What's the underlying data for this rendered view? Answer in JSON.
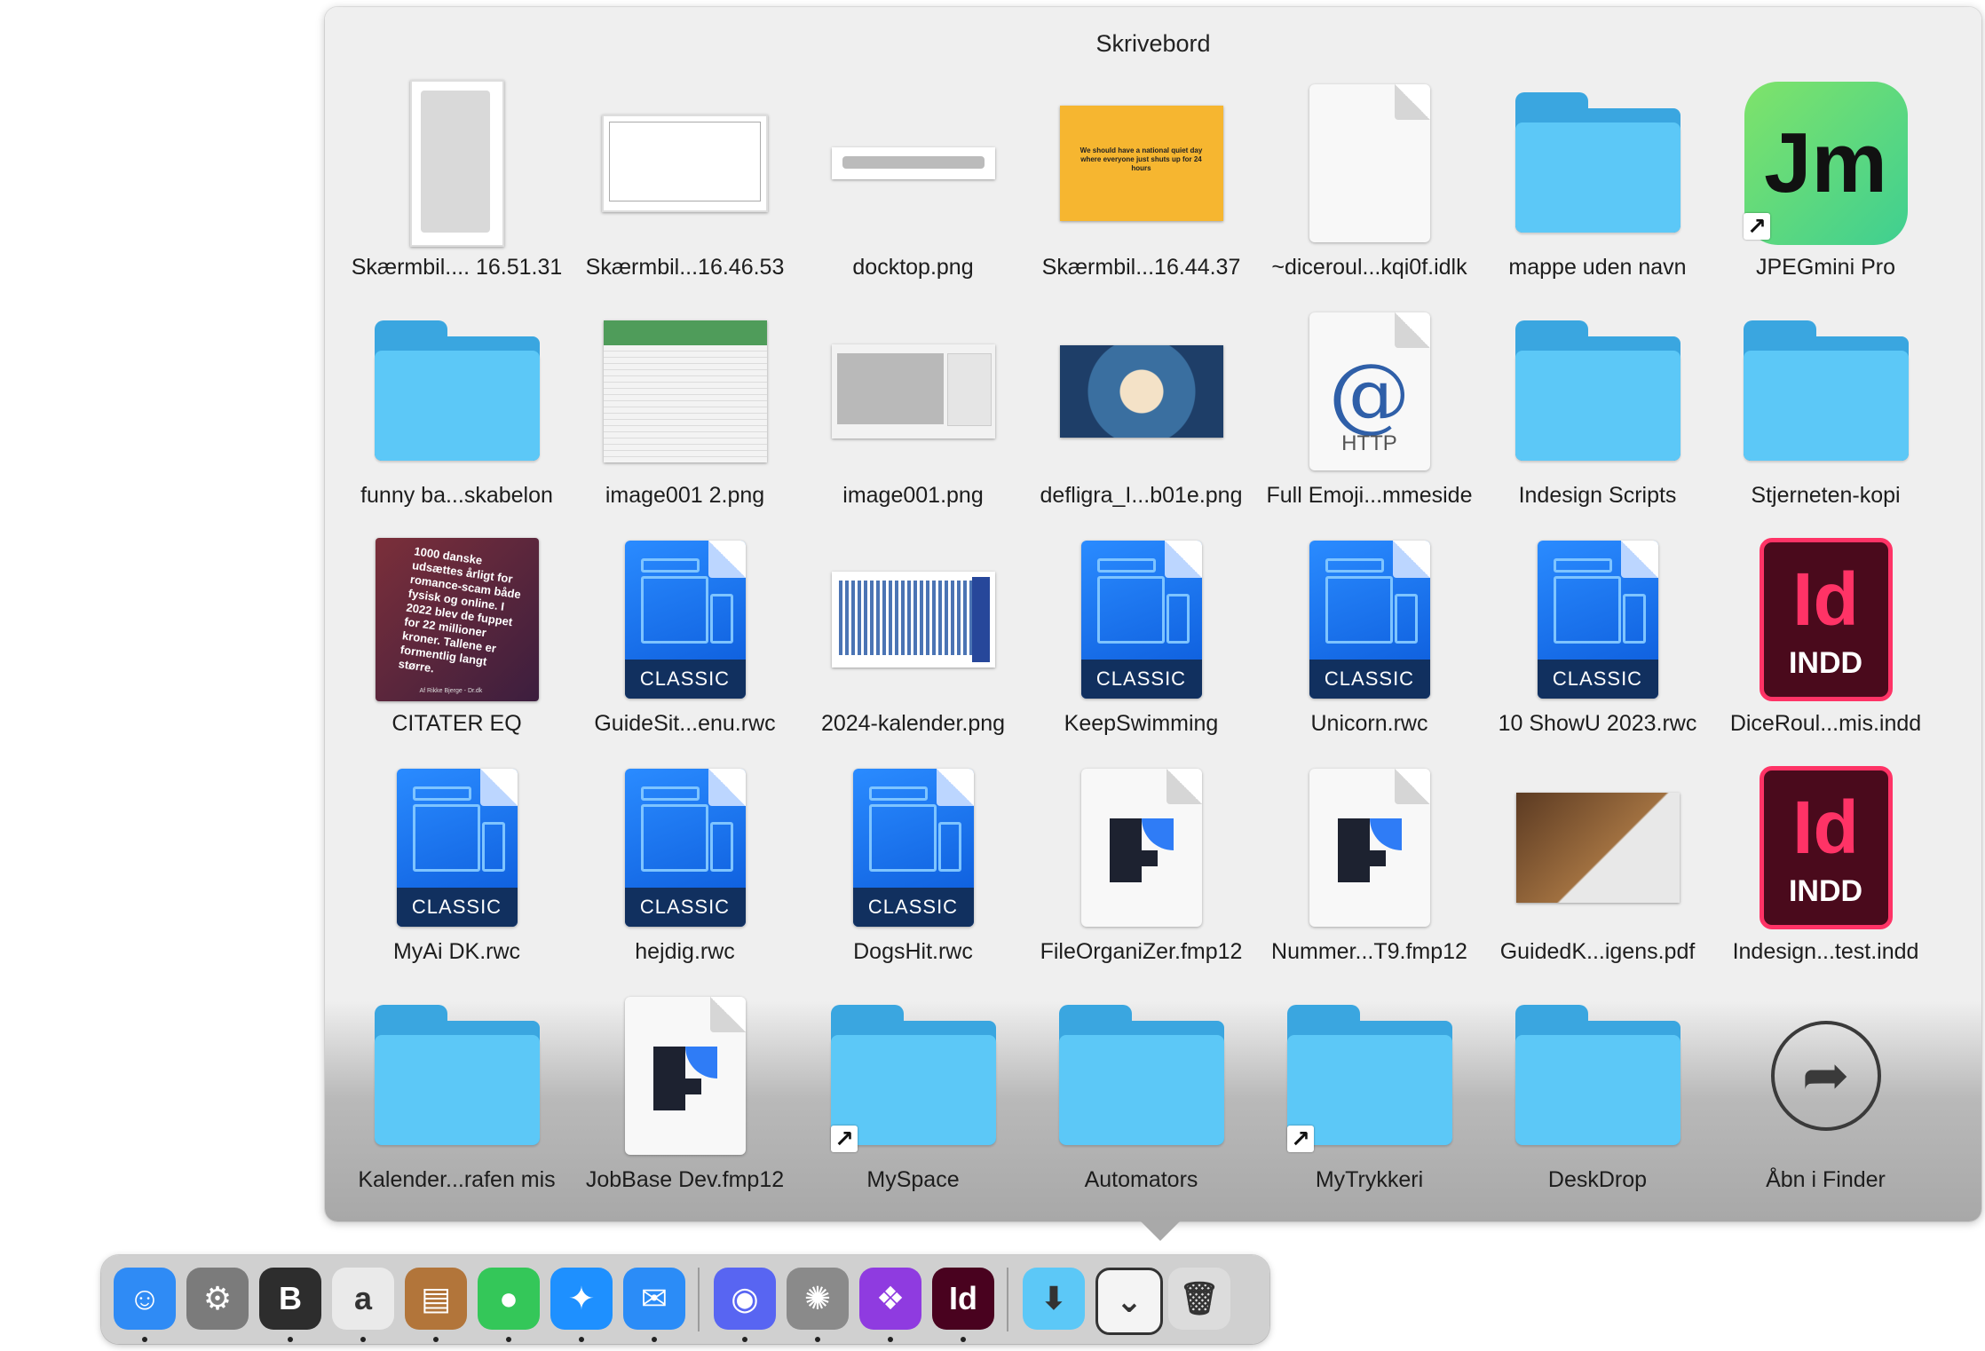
{
  "stack": {
    "title": "Skrivebord",
    "items": [
      {
        "label": "Skærmbil.... 16.51.31",
        "kind": "screenshot-menu"
      },
      {
        "label": "Skærmbil...16.46.53",
        "kind": "screenshot-blank"
      },
      {
        "label": "docktop.png",
        "kind": "screenshot-dock"
      },
      {
        "label": "Skærmbil...16.44.37",
        "kind": "screenshot-yellow",
        "thumb_text": "We should have a national quiet day where everyone just shuts up for 24 hours"
      },
      {
        "label": "~diceroul...kqi0f.idlk",
        "kind": "document"
      },
      {
        "label": "mappe uden navn",
        "kind": "folder"
      },
      {
        "label": "JPEGmini Pro",
        "kind": "app-jpegmini",
        "icon_text": "Jm",
        "alias": true
      },
      {
        "label": "funny ba...skabelon",
        "kind": "folder"
      },
      {
        "label": "image001 2.png",
        "kind": "screenshot-table"
      },
      {
        "label": "image001.png",
        "kind": "screenshot-app"
      },
      {
        "label": "defligra_I...b01e.png",
        "kind": "image-face"
      },
      {
        "label": "Full Emoji...mmeside",
        "kind": "http",
        "icon_text": "HTTP"
      },
      {
        "label": "Indesign Scripts",
        "kind": "folder"
      },
      {
        "label": "Stjerneten-kopi",
        "kind": "folder"
      },
      {
        "label": "CITATER EQ",
        "kind": "quote-image",
        "thumb_text": "1000 danske udsættes årligt for romance-scam både fysisk og online. I 2022 blev de fuppet for 22 millioner kroner. Tallene er formentlig langt større.",
        "thumb_credit": "Af Rikke Bjerge - Dr.dk"
      },
      {
        "label": "GuideSit...enu.rwc",
        "kind": "rwc",
        "icon_text": "CLASSIC"
      },
      {
        "label": "2024-kalender.png",
        "kind": "calendar"
      },
      {
        "label": "KeepSwimming",
        "kind": "rwc",
        "icon_text": "CLASSIC"
      },
      {
        "label": "Unicorn.rwc",
        "kind": "rwc",
        "icon_text": "CLASSIC"
      },
      {
        "label": "10 ShowU 2023.rwc",
        "kind": "rwc",
        "icon_text": "CLASSIC"
      },
      {
        "label": "DiceRoul...mis.indd",
        "kind": "indd",
        "icon_text": "Id",
        "icon_sub": "INDD"
      },
      {
        "label": "MyAi DK.rwc",
        "kind": "rwc",
        "icon_text": "CLASSIC"
      },
      {
        "label": "hejdig.rwc",
        "kind": "rwc",
        "icon_text": "CLASSIC"
      },
      {
        "label": "DogsHit.rwc",
        "kind": "rwc",
        "icon_text": "CLASSIC"
      },
      {
        "label": "FileOrganiZer.fmp12",
        "kind": "fmp"
      },
      {
        "label": "Nummer...T9.fmp12",
        "kind": "fmp"
      },
      {
        "label": "GuidedK...igens.pdf",
        "kind": "pdf-photo"
      },
      {
        "label": "Indesign...test.indd",
        "kind": "indd",
        "icon_text": "Id",
        "icon_sub": "INDD"
      },
      {
        "label": "Kalender...rafen mis",
        "kind": "folder"
      },
      {
        "label": "JobBase Dev.fmp12",
        "kind": "fmp"
      },
      {
        "label": "MySpace",
        "kind": "folder",
        "alias": true
      },
      {
        "label": "Automators",
        "kind": "folder"
      },
      {
        "label": "MyTrykkeri",
        "kind": "folder",
        "alias": true
      },
      {
        "label": "DeskDrop",
        "kind": "folder"
      },
      {
        "label": "Åbn i Finder",
        "kind": "open-finder"
      }
    ]
  },
  "dock": {
    "apps": [
      {
        "name": "finder-icon",
        "glyph": "☺",
        "color": "#2f8bf5",
        "running": true
      },
      {
        "name": "system-settings-icon",
        "glyph": "⚙",
        "color": "#7b7b7b",
        "running": false
      },
      {
        "name": "bbedit-icon",
        "glyph": "B",
        "color": "#2d2d2d",
        "running": true
      },
      {
        "name": "script-editor-icon",
        "glyph": "a",
        "color": "#eaeaea",
        "running": true
      },
      {
        "name": "archive-app-icon",
        "glyph": "▤",
        "color": "#b2753a",
        "running": true
      },
      {
        "name": "messages-icon",
        "glyph": "●",
        "color": "#34c759",
        "running": true
      },
      {
        "name": "safari-icon",
        "glyph": "✦",
        "color": "#1e90ff",
        "running": true
      },
      {
        "name": "mail-icon",
        "glyph": "✉",
        "color": "#2b8cf7",
        "running": true
      },
      {
        "name": "discord-icon",
        "glyph": "◉",
        "color": "#5865f2",
        "running": true
      },
      {
        "name": "automator-icon",
        "glyph": "✺",
        "color": "#8a8a8a",
        "running": true
      },
      {
        "name": "setapp-icon",
        "glyph": "❖",
        "color": "#8f3be0",
        "running": true
      },
      {
        "name": "indesign-icon",
        "glyph": "Id",
        "color": "#49021f",
        "running": true
      }
    ],
    "stacks": [
      {
        "name": "downloads-folder-icon",
        "glyph": "⬇",
        "color": "#5cc8f7"
      },
      {
        "name": "desktop-stack-icon",
        "glyph": "⌄",
        "color": "#f4f4f4"
      },
      {
        "name": "trash-icon",
        "glyph": "🗑",
        "color": "#dcdcdc"
      }
    ]
  }
}
